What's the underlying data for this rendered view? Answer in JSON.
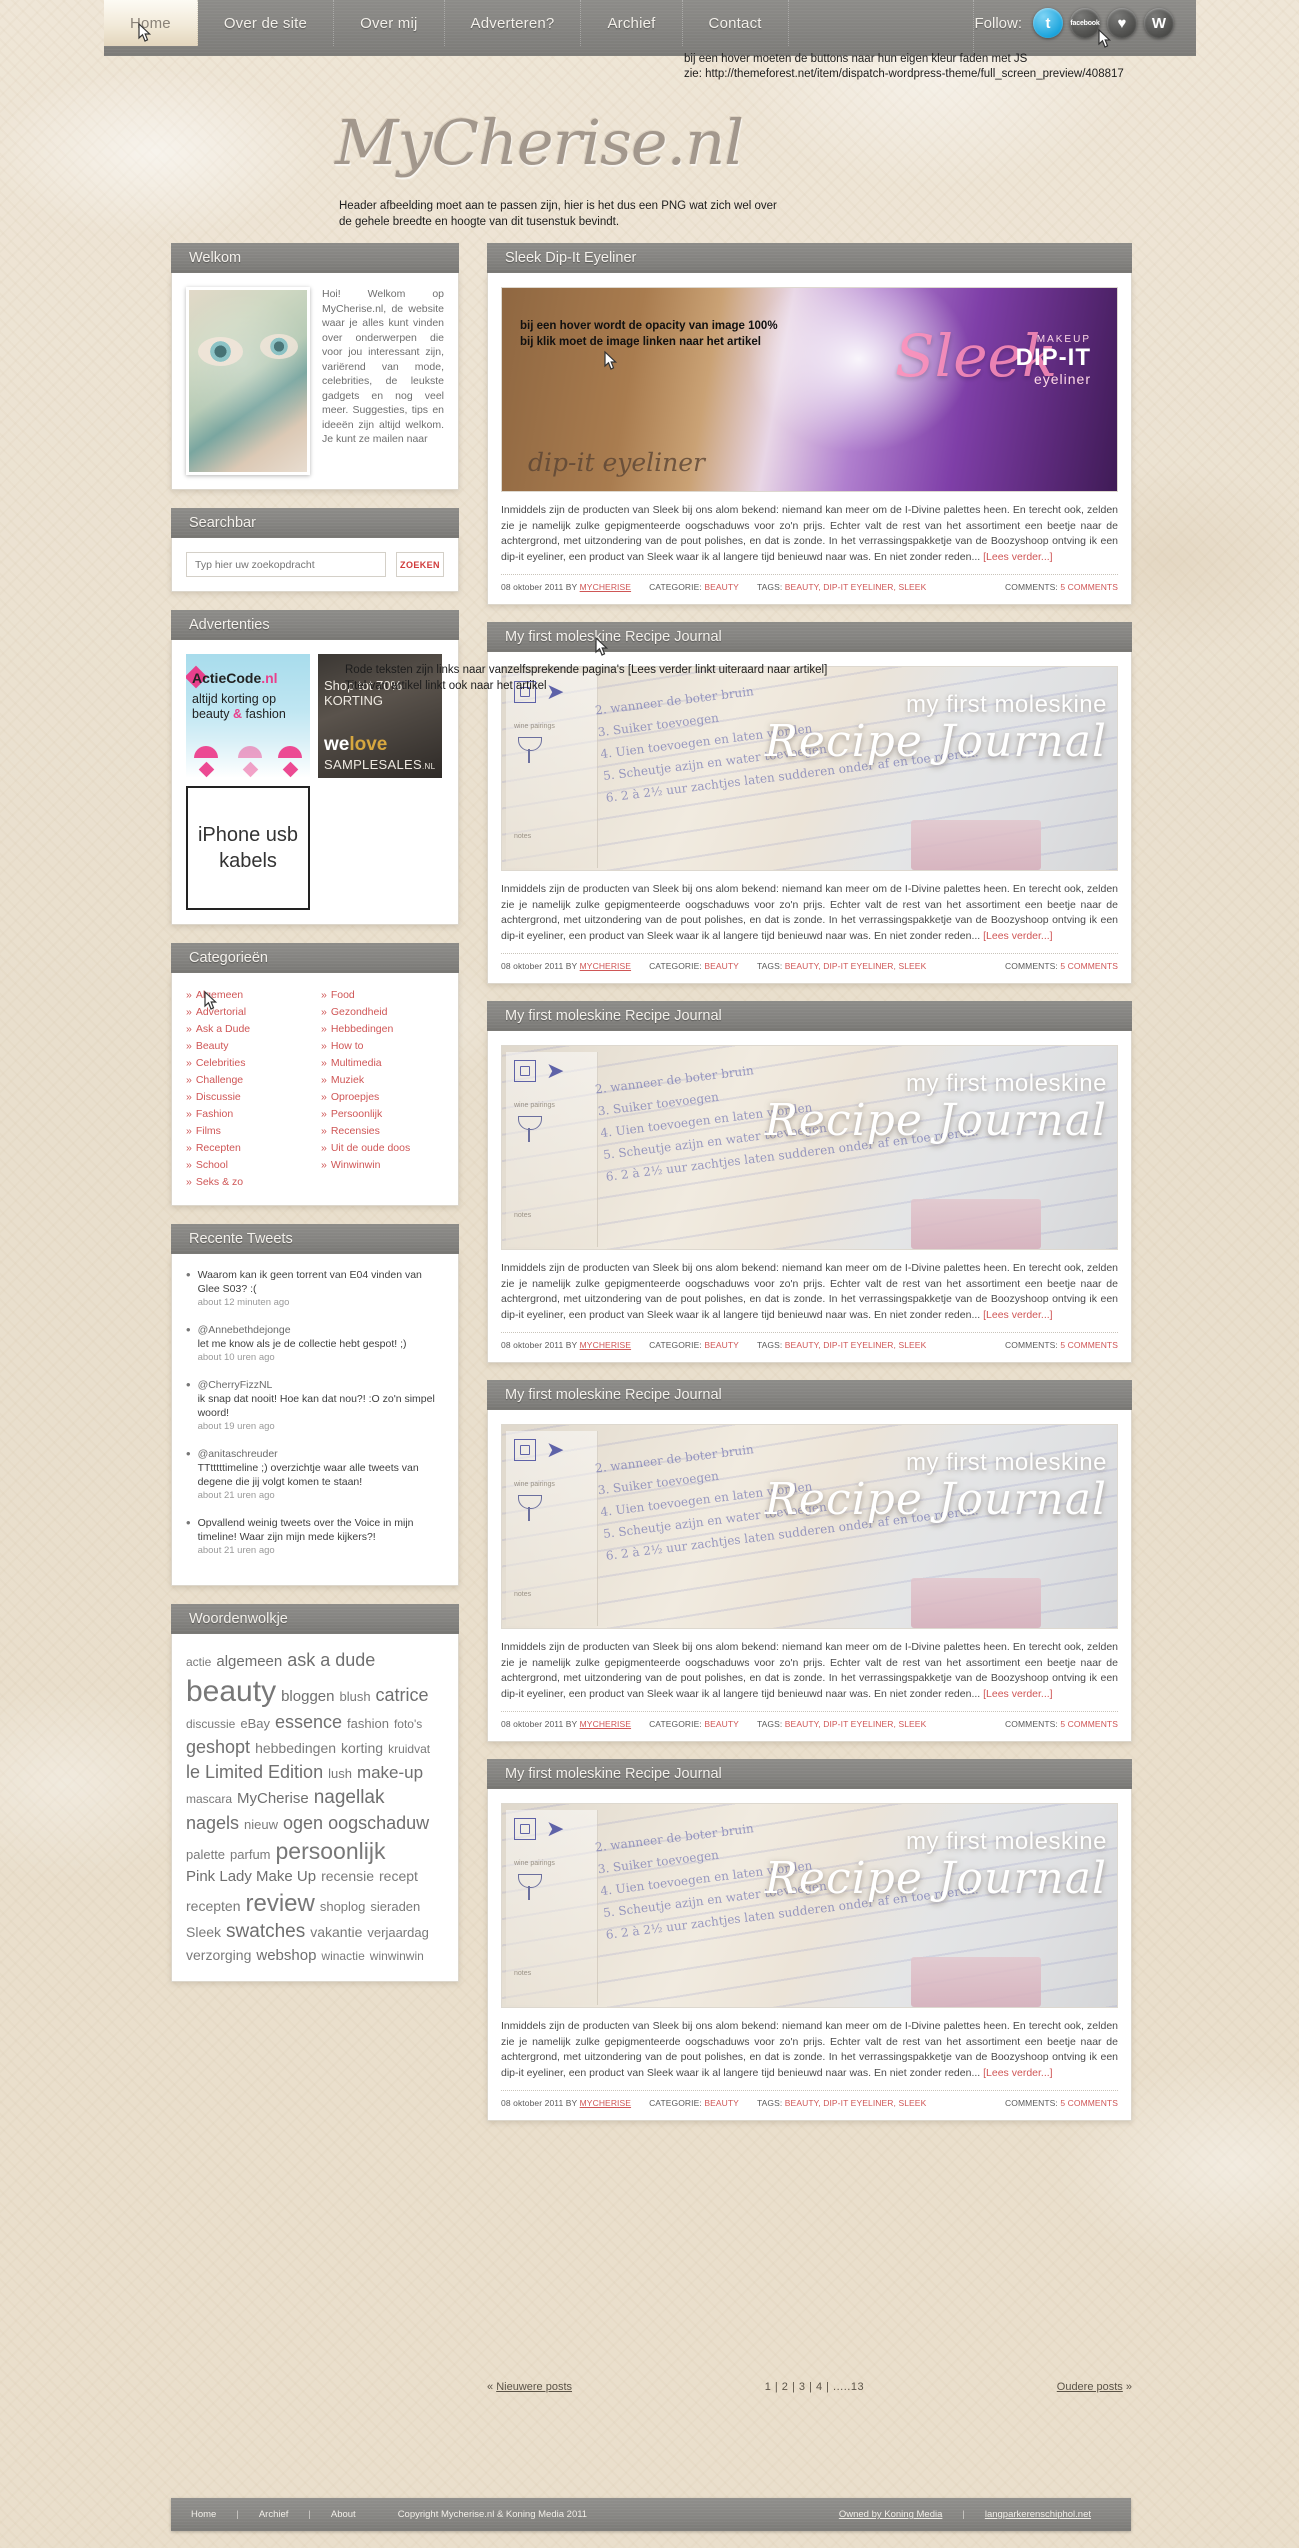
{
  "nav": {
    "items": [
      {
        "label": "Home",
        "active": true
      },
      {
        "label": "Over de site",
        "active": false
      },
      {
        "label": "Over mij",
        "active": false
      },
      {
        "label": "Adverteren?",
        "active": false
      },
      {
        "label": "Archief",
        "active": false
      },
      {
        "label": "Contact",
        "active": false
      }
    ],
    "follow_label": "Follow:",
    "social": [
      {
        "name": "twitter-icon",
        "glyph": "t"
      },
      {
        "name": "facebook-icon",
        "glyph": "facebook"
      },
      {
        "name": "heart-icon",
        "glyph": "♥"
      },
      {
        "name": "wordpress-icon",
        "glyph": "W"
      }
    ]
  },
  "annotations": {
    "top": "bij een hover moeten de buttons naar hun eigen kleur faden met JS\nzie: http://themeforest.net/item/dispatch-wordpress-theme/full_screen_preview/408817",
    "header": "Header afbeelding moet aan te passen zijn, hier is het dus een PNG wat zich wel over\nde gehele breedte en hoogte van dit tusenstuk bevindt.",
    "image": "bij een hover wordt de opacity van image 100%\nbij klik moet de image linken naar het artikel",
    "links": "Rode teksten zijn links naar vanzelfsprekende pagina's [Lees verder linkt uiteraard naar artikel]\nTitel van artikel linkt ook naar het artikel"
  },
  "logo": {
    "text": "MyCherise.nl"
  },
  "sidebar": {
    "welkom": {
      "title": "Welkom",
      "text": "Hoi! Welkom op MyCherise.nl, de website waar je alles kunt vinden over onderwerpen die voor jou interessant zijn, variërend van mode, celebrities, de leukste gadgets en nog veel meer. Suggesties, tips en ideeën zijn altijd welkom. Je kunt ze mailen naar"
    },
    "search": {
      "title": "Searchbar",
      "placeholder": "Typ hier uw zoekopdracht",
      "button": "ZOEKEN"
    },
    "ads": {
      "title": "Advertenties",
      "ad1_brand": "ActieCode",
      "ad1_tld": ".nl",
      "ad1_line1": "altijd korting op",
      "ad1_line2a": "beauty ",
      "ad1_line2b": "&",
      "ad1_line2c": " fashion",
      "ad2_line1": "Shop tot 70%",
      "ad2_line2": "KORTING",
      "ad2_we": "we",
      "ad2_love": "love",
      "ad2_sub": "SAMPLESALES",
      "ad2_tld": ".NL",
      "ad3_text": "iPhone usb kabels"
    },
    "categories": {
      "title": "Categorieën",
      "col1": [
        "Algemeen",
        "Advertorial",
        "Ask a Dude",
        "Beauty",
        "Celebrities",
        "Challenge",
        "Discussie",
        "Fashion",
        "Films",
        "Recepten",
        "School",
        "Seks & zo"
      ],
      "col2": [
        "Food",
        "Gezondheid",
        "Hebbedingen",
        "How to",
        "Multimedia",
        "Muziek",
        "Oproepjes",
        "Persoonlijk",
        "Recensies",
        "Uit de oude doos",
        "Winwinwin"
      ]
    },
    "tweets": {
      "title": "Recente Tweets",
      "items": [
        {
          "handle": "",
          "text": "Waarom kan ik geen torrent van E04 vinden van Glee S03? :(",
          "time": "about 12 minuten ago"
        },
        {
          "handle": "@Annebethdejonge",
          "text": "let me know als je de collectie hebt gespot! ;)",
          "time": "about 10 uren ago"
        },
        {
          "handle": "@CherryFizzNL",
          "text": "ik snap dat nooit! Hoe kan dat nou?! :O zo'n simpel woord!",
          "time": "about 19 uren ago"
        },
        {
          "handle": "@anitaschreuder",
          "text": "TTtttttimeline ;) overzichtje waar alle tweets van degene die jij volgt komen te staan!",
          "time": "about 21 uren ago"
        },
        {
          "handle": "",
          "text": "Opvallend weinig tweets over the Voice in mijn timeline! Waar zijn mijn mede kijkers?!",
          "time": "about 21 uren ago"
        }
      ]
    },
    "cloud": {
      "title": "Woordenwolkje",
      "tags": [
        {
          "label": "actie",
          "size": 12
        },
        {
          "label": "algemeen",
          "size": 15
        },
        {
          "label": "ask a dude",
          "size": 18
        },
        {
          "label": "beauty",
          "size": 30
        },
        {
          "label": "bloggen",
          "size": 15
        },
        {
          "label": "blush",
          "size": 13
        },
        {
          "label": "catrice",
          "size": 18
        },
        {
          "label": "discussie",
          "size": 12
        },
        {
          "label": "eBay",
          "size": 13
        },
        {
          "label": "essence",
          "size": 18
        },
        {
          "label": "fashion",
          "size": 13
        },
        {
          "label": "foto's",
          "size": 12
        },
        {
          "label": "geshopt",
          "size": 18
        },
        {
          "label": "hebbedingen",
          "size": 14
        },
        {
          "label": "korting",
          "size": 14
        },
        {
          "label": "kruidvat",
          "size": 12
        },
        {
          "label": "le Limited Edition",
          "size": 18
        },
        {
          "label": "lush",
          "size": 13
        },
        {
          "label": "make-up",
          "size": 17
        },
        {
          "label": "mascara",
          "size": 12
        },
        {
          "label": "MyCherise",
          "size": 15
        },
        {
          "label": "nagellak",
          "size": 19
        },
        {
          "label": "nagels",
          "size": 18
        },
        {
          "label": "nieuw",
          "size": 13
        },
        {
          "label": "ogen",
          "size": 18
        },
        {
          "label": "oogschaduw",
          "size": 18
        },
        {
          "label": "palette",
          "size": 13
        },
        {
          "label": "parfum",
          "size": 13
        },
        {
          "label": "persoonlijk",
          "size": 23
        },
        {
          "label": "Pink Lady Make Up",
          "size": 15
        },
        {
          "label": "recensie",
          "size": 14
        },
        {
          "label": "recept",
          "size": 14
        },
        {
          "label": "recepten",
          "size": 14
        },
        {
          "label": "review",
          "size": 24
        },
        {
          "label": "shoplog",
          "size": 13
        },
        {
          "label": "sieraden",
          "size": 13
        },
        {
          "label": "Sleek",
          "size": 14
        },
        {
          "label": "swatches",
          "size": 19
        },
        {
          "label": "vakantie",
          "size": 14
        },
        {
          "label": "verjaardag",
          "size": 13
        },
        {
          "label": "verzorging",
          "size": 14
        },
        {
          "label": "webshop",
          "size": 15
        },
        {
          "label": "winactie",
          "size": 12
        },
        {
          "label": "winwinwin",
          "size": 12
        }
      ]
    }
  },
  "posts": [
    {
      "title": "Sleek Dip-It Eyeliner",
      "image_kind": "eyeliner",
      "image_brand": "Sleek",
      "image_makeup": "MAKEUP",
      "image_dipit": "DIP-IT",
      "image_eyeliner": "eyeliner",
      "image_sub": "dip-it eyeliner",
      "text": "Inmiddels zijn de producten van Sleek bij ons alom bekend: niemand kan meer om de I-Divine palettes heen. En terecht ook, zelden zie je namelijk zulke gepigmenteerde oogschaduws voor zo'n prijs. Echter valt de rest van het assortiment een beetje naar de achtergrond, met uitzondering van de pout polishes, en dat is zonde. In het verrassingspakketje van de Boozyshoop ontving ik een dip-it eyeliner, een product van Sleek waar ik al langere tijd benieuwd naar was. En niet zonder reden...",
      "more": "[Lees verder...]",
      "date": "08 oktober 2011 BY",
      "author": "MYCHERISE",
      "cat_label": "CATEGORIE:",
      "cat_value": "BEAUTY",
      "tags_label": "TAGS:",
      "tags_value": "BEAUTY, DIP-IT EYELINER, SLEEK",
      "comments_label": "COMMENTS:",
      "comments_value": "5 COMMENTS"
    },
    {
      "title": "My first moleskine Recipe Journal",
      "image_kind": "mole",
      "image_t1": "my first moleskine",
      "image_t2": "Recipe Journal",
      "image_hand": "2. wanneer de boter bruin\n3. Suiker toevoegen\n4. Uien toevoegen en laten worden\n5. Scheutje azijn en water toevoegen\n6. 2 à 2½ uur zachtjes laten sudderen onder af en toe roeren.",
      "image_lbl1": "wine pairings",
      "image_lbl2": "notes",
      "text": "Inmiddels zijn de producten van Sleek bij ons alom bekend: niemand kan meer om de I-Divine palettes heen. En terecht ook, zelden zie je namelijk zulke gepigmenteerde oogschaduws voor zo'n prijs. Echter valt de rest van het assortiment een beetje naar de achtergrond, met uitzondering van de pout polishes, en dat is zonde. In het verrassingspakketje van de Boozyshoop ontving ik een dip-it eyeliner, een product van Sleek waar ik al langere tijd benieuwd naar was. En niet zonder reden...",
      "more": "[Lees verder...]",
      "date": "08 oktober 2011 BY",
      "author": "MYCHERISE",
      "cat_label": "CATEGORIE:",
      "cat_value": "BEAUTY",
      "tags_label": "TAGS:",
      "tags_value": "BEAUTY, DIP-IT EYELINER, SLEEK",
      "comments_label": "COMMENTS:",
      "comments_value": "5 COMMENTS"
    },
    {
      "title": "My first moleskine Recipe Journal",
      "image_kind": "mole",
      "image_t1": "my first moleskine",
      "image_t2": "Recipe Journal",
      "image_hand": "2. wanneer de boter bruin\n3. Suiker toevoegen\n4. Uien toevoegen en laten worden\n5. Scheutje azijn en water toevoegen\n6. 2 à 2½ uur zachtjes laten sudderen onder af en toe roeren.",
      "image_lbl1": "wine pairings",
      "image_lbl2": "notes",
      "text": "Inmiddels zijn de producten van Sleek bij ons alom bekend: niemand kan meer om de I-Divine palettes heen. En terecht ook, zelden zie je namelijk zulke gepigmenteerde oogschaduws voor zo'n prijs. Echter valt de rest van het assortiment een beetje naar de achtergrond, met uitzondering van de pout polishes, en dat is zonde. In het verrassingspakketje van de Boozyshoop ontving ik een dip-it eyeliner, een product van Sleek waar ik al langere tijd benieuwd naar was. En niet zonder reden...",
      "more": "[Lees verder...]",
      "date": "08 oktober 2011 BY",
      "author": "MYCHERISE",
      "cat_label": "CATEGORIE:",
      "cat_value": "BEAUTY",
      "tags_label": "TAGS:",
      "tags_value": "BEAUTY, DIP-IT EYELINER, SLEEK",
      "comments_label": "COMMENTS:",
      "comments_value": "5 COMMENTS"
    },
    {
      "title": "My first moleskine Recipe Journal",
      "image_kind": "mole",
      "image_t1": "my first moleskine",
      "image_t2": "Recipe Journal",
      "image_hand": "2. wanneer de boter bruin\n3. Suiker toevoegen\n4. Uien toevoegen en laten worden\n5. Scheutje azijn en water toevoegen\n6. 2 à 2½ uur zachtjes laten sudderen onder af en toe roeren.",
      "image_lbl1": "wine pairings",
      "image_lbl2": "notes",
      "text": "Inmiddels zijn de producten van Sleek bij ons alom bekend: niemand kan meer om de I-Divine palettes heen. En terecht ook, zelden zie je namelijk zulke gepigmenteerde oogschaduws voor zo'n prijs. Echter valt de rest van het assortiment een beetje naar de achtergrond, met uitzondering van de pout polishes, en dat is zonde. In het verrassingspakketje van de Boozyshoop ontving ik een dip-it eyeliner, een product van Sleek waar ik al langere tijd benieuwd naar was. En niet zonder reden...",
      "more": "[Lees verder...]",
      "date": "08 oktober 2011 BY",
      "author": "MYCHERISE",
      "cat_label": "CATEGORIE:",
      "cat_value": "BEAUTY",
      "tags_label": "TAGS:",
      "tags_value": "BEAUTY, DIP-IT EYELINER, SLEEK",
      "comments_label": "COMMENTS:",
      "comments_value": "5 COMMENTS"
    },
    {
      "title": "My first moleskine Recipe Journal",
      "image_kind": "mole",
      "image_t1": "my first moleskine",
      "image_t2": "Recipe Journal",
      "image_hand": "2. wanneer de boter bruin\n3. Suiker toevoegen\n4. Uien toevoegen en laten worden\n5. Scheutje azijn en water toevoegen\n6. 2 à 2½ uur zachtjes laten sudderen onder af en toe roeren.",
      "image_lbl1": "wine pairings",
      "image_lbl2": "notes",
      "text": "Inmiddels zijn de producten van Sleek bij ons alom bekend: niemand kan meer om de I-Divine palettes heen. En terecht ook, zelden zie je namelijk zulke gepigmenteerde oogschaduws voor zo'n prijs. Echter valt de rest van het assortiment een beetje naar de achtergrond, met uitzondering van de pout polishes, en dat is zonde. In het verrassingspakketje van de Boozyshoop ontving ik een dip-it eyeliner, een product van Sleek waar ik al langere tijd benieuwd naar was. En niet zonder reden...",
      "more": "[Lees verder...]",
      "date": "08 oktober 2011 BY",
      "author": "MYCHERISE",
      "cat_label": "CATEGORIE:",
      "cat_value": "BEAUTY",
      "tags_label": "TAGS:",
      "tags_value": "BEAUTY, DIP-IT EYELINER, SLEEK",
      "comments_label": "COMMENTS:",
      "comments_value": "5 COMMENTS"
    }
  ],
  "pagination": {
    "prev_arrow": "«",
    "prev": "Nieuwere posts",
    "numbers": "1 | 2 | 3 | 4 | .....13",
    "next": "Oudere posts",
    "next_arrow": "»"
  },
  "footer": {
    "links": [
      "Home",
      "Archief",
      "About"
    ],
    "copyright": "Copyright Mycherise.nl & Koning Media 2011",
    "owned": "Owned by Koning Media",
    "partner": "langparkerenschiphol.net",
    "sep": "|"
  }
}
